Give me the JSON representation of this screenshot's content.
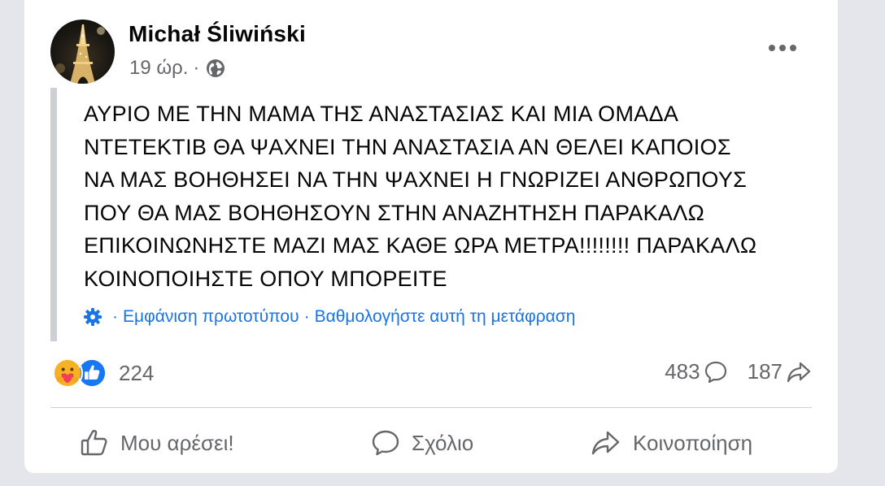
{
  "post": {
    "author": "Michał Śliwiński",
    "timestamp": "19 ώρ.",
    "meta_separator": "·",
    "privacy_icon": "globe-icon",
    "text": "ΑΥΡΙΟ ΜΕ ΤΗΝ ΜΑΜΑ ΤΗΣ ΑΝΑΣΤΑΣΙΑΣ ΚΑΙ ΜΙΑ ΟΜΑΔΑ\nΝΤΕΤΕΚΤΙΒ ΘΑ ΨΑΧΝΕΙ ΤΗΝ ΑΝΑΣΤΑΣΙΑ ΑΝ ΘΕΛΕΙ ΚΑΠΟΙΟΣ\nΝΑ ΜΑΣ ΒΟΗΘΗΣΕΙ ΝΑ ΤΗΝ ΨΑΧΝΕΙ Η ΓΝΩΡΙΖΕΙ ΑΝΘΡΩΠΟΥΣ\nΠΟΥ ΘΑ ΜΑΣ ΒΟΗΘΗΣΟΥΝ ΣΤΗΝ ΑΝΑΖΗΤΗΣΗ ΠΑΡΑΚΑΛΩ\nΕΠΙΚΟΙΝΩΝΗΣΤΕ ΜΑΖΙ ΜΑΣ ΚΑΘΕ ΩΡΑ ΜΕΤΡΑ!!!!!!!! ΠΑΡΑΚΑΛΩ\nΚΟΙΝΟΠΟΙΗΣΤΕ ΟΠΟΥ ΜΠΟΡΕΙΤΕ"
  },
  "translation": {
    "separator": "·",
    "see_original": "Εμφάνιση πρωτοτύπου",
    "rate_translation": "Βαθμολογήστε αυτή τη μετάφραση"
  },
  "stats": {
    "reactions_count": "224",
    "comments_count": "483",
    "shares_count": "187",
    "reaction_icons": [
      "care-icon",
      "like-reaction-icon"
    ]
  },
  "actions": {
    "like": "Μου αρέσει!",
    "comment": "Σχόλιο",
    "share": "Κοινοποίηση"
  },
  "colors": {
    "link": "#1b74e4",
    "secondary_text": "#65676b",
    "primary_text": "#050505",
    "like_blue": "#1877f2",
    "care_yellow": "#f7b125",
    "background": "#e4e6eb",
    "card": "#ffffff"
  }
}
